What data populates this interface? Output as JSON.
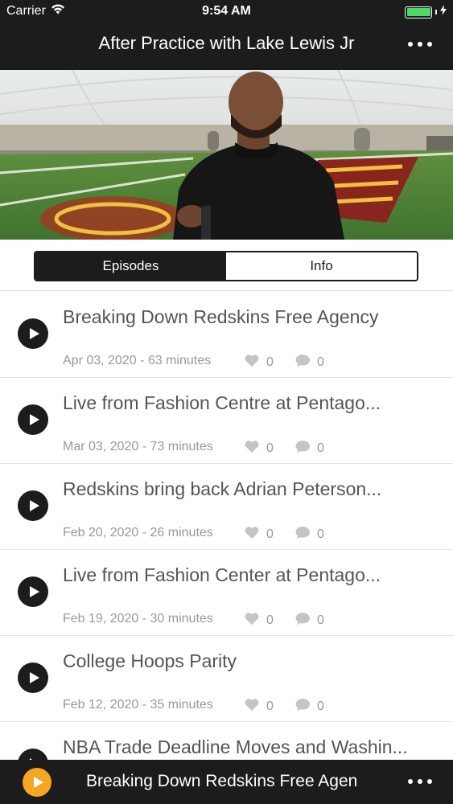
{
  "status_bar": {
    "carrier": "Carrier",
    "time": "9:54 AM"
  },
  "nav": {
    "title": "After Practice with Lake Lewis Jr",
    "more_icon": "more-dots-icon"
  },
  "segments": {
    "items": [
      "Episodes",
      "Info"
    ],
    "selected": "Episodes"
  },
  "episodes": [
    {
      "title": "Breaking Down Redskins Free Agency",
      "meta": "Apr 03, 2020 - 63 minutes",
      "likes": "0",
      "comments": "0"
    },
    {
      "title": "Live from Fashion Centre at Pentago...",
      "meta": "Mar 03, 2020 - 73 minutes",
      "likes": "0",
      "comments": "0"
    },
    {
      "title": "Redskins bring back Adrian Peterson...",
      "meta": "Feb 20, 2020 - 26 minutes",
      "likes": "0",
      "comments": "0"
    },
    {
      "title": "Live from Fashion Center at Pentago...",
      "meta": "Feb 19, 2020 - 30 minutes",
      "likes": "0",
      "comments": "0"
    },
    {
      "title": "College Hoops Parity",
      "meta": "Feb 12, 2020 - 35 minutes",
      "likes": "0",
      "comments": "0"
    },
    {
      "title": "NBA Trade Deadline Moves and Washin...",
      "meta": "",
      "likes": "",
      "comments": ""
    }
  ],
  "player": {
    "now_playing": "Breaking Down Redskins Free Agen",
    "accent": "#f5a623"
  },
  "colors": {
    "bar_bg": "#1c1c1c",
    "battery": "#4cd964"
  }
}
